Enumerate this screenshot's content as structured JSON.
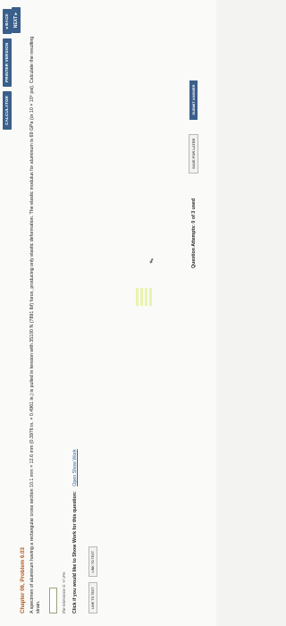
{
  "toolbar": {
    "calculator": "CALCULATOR",
    "printer": "PRINTER VERSION",
    "back": "◂ BACK",
    "next": "NEXT ▸"
  },
  "problem": {
    "chapter": "Chapter 06, Problem 6.03",
    "text": "A specimen of aluminum having a rectangular cross section 10.1 mm × 12.6 mm (0.3976 in. × 0.4961 in.) is pulled in tension with 35100 N (7891 lbf) force, producing only elastic deformation. The elastic modulus for aluminum is 69 GPa (or 10 × 10⁶ psi). Calculate the resulting strain.",
    "answer_value": "",
    "tolerance": "the tolerance is +/-2%",
    "show_work_prompt": "Click if you would like to Show Work for this question:",
    "show_work_link": "Open Show Work"
  },
  "links": {
    "link1": "LINK TO TEXT",
    "link2": "LINK TO TEXT"
  },
  "footer": {
    "attempts": "Question Attempts: 0 of 3 used",
    "save": "SAVE FOR LATER",
    "submit": "SUBMIT ANSWER"
  }
}
